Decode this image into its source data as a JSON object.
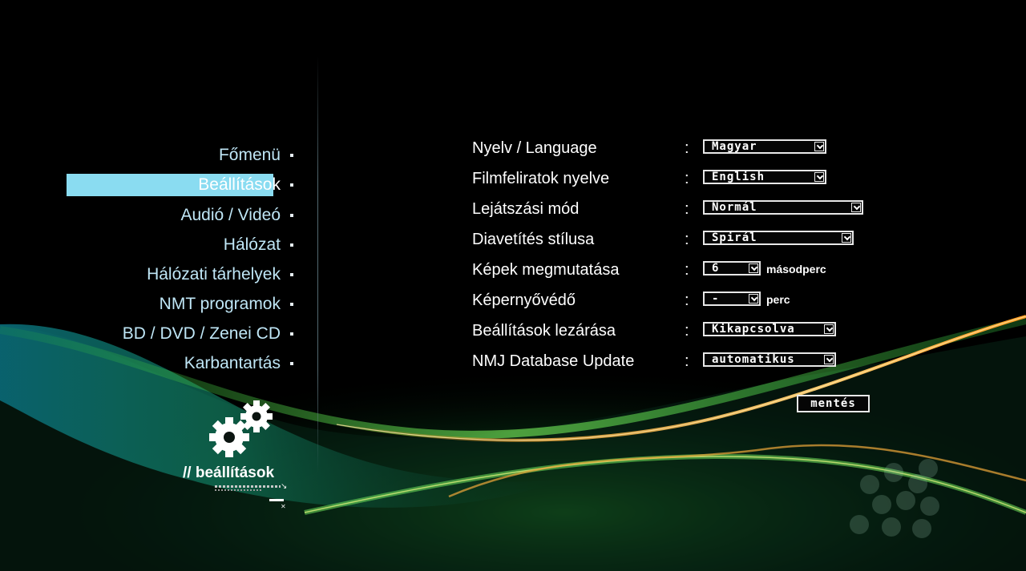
{
  "sidebar": {
    "items": [
      {
        "label": "Főmenü",
        "active": false
      },
      {
        "label": "Beállítások",
        "active": true
      },
      {
        "label": "Audió / Videó",
        "active": false
      },
      {
        "label": "Hálózat",
        "active": false
      },
      {
        "label": "Hálózati tárhelyek",
        "active": false
      },
      {
        "label": "NMT programok",
        "active": false
      },
      {
        "label": "BD / DVD / Zenei CD",
        "active": false
      },
      {
        "label": "Karbantartás",
        "active": false
      }
    ],
    "caption": "// beállítások",
    "icon": "gears-icon"
  },
  "settings": {
    "rows": [
      {
        "label": "Nyelv / Language",
        "value": "Magyar",
        "unit": ""
      },
      {
        "label": "Filmfeliratok nyelve",
        "value": "English",
        "unit": ""
      },
      {
        "label": "Lejátszási mód",
        "value": "Normál",
        "unit": ""
      },
      {
        "label": "Diavetítés stílusa",
        "value": "Spirál",
        "unit": ""
      },
      {
        "label": "Képek megmutatása",
        "value": "6",
        "unit": "másodperc"
      },
      {
        "label": "Képernyővédő",
        "value": "-",
        "unit": "perc"
      },
      {
        "label": "Beállítások lezárása",
        "value": "Kikapcsolva",
        "unit": ""
      },
      {
        "label": "NMJ Database Update",
        "value": "automatikus",
        "unit": ""
      }
    ],
    "separator": ":"
  },
  "save_label": "mentés",
  "colors": {
    "background": "#000000",
    "menu_text": "#bfe6f6",
    "menu_highlight": "#8adcf1",
    "wave_green": "#3fd84a",
    "wave_orange": "#e8961e",
    "wave_teal": "#1a8a9a"
  }
}
